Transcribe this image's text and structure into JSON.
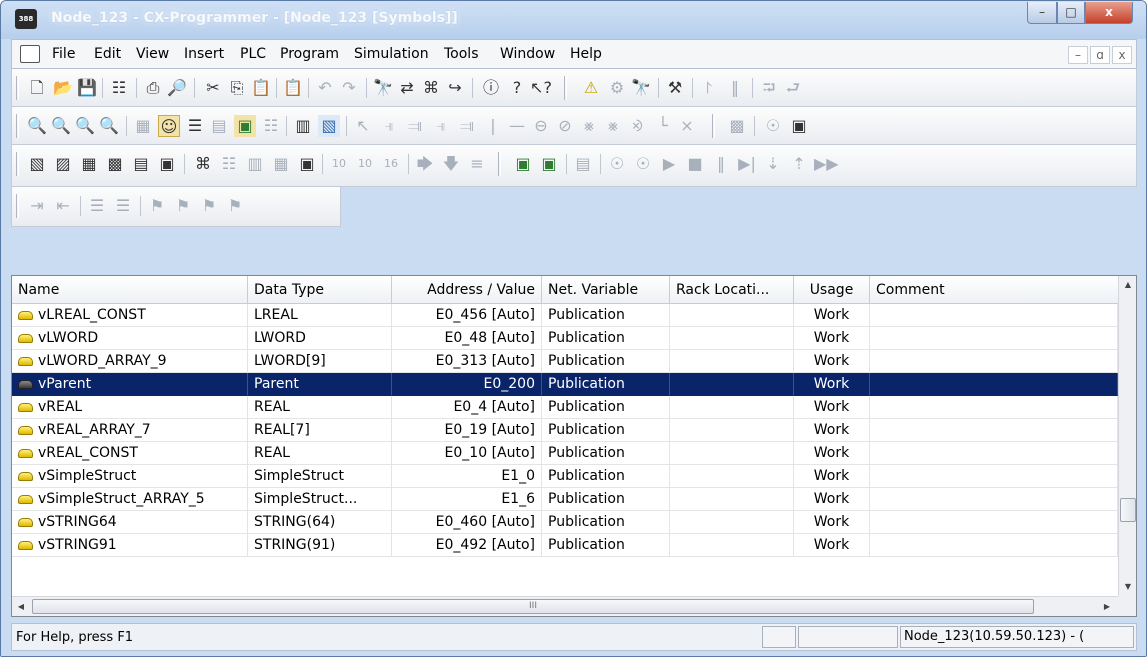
{
  "window": {
    "title": "Node_123 - CX-Programmer - [Node_123 [Symbols]]",
    "app_icon_text": "388",
    "min_label": "–",
    "max_label": "□",
    "close_label": "x"
  },
  "menu": {
    "items": [
      "File",
      "Edit",
      "View",
      "Insert",
      "PLC",
      "Program",
      "Simulation",
      "Tools",
      "Window",
      "Help"
    ],
    "mdi_min": "–",
    "mdi_restore": "ɑ",
    "mdi_close": "x"
  },
  "table": {
    "columns": [
      "Name",
      "Data Type",
      "Address / Value",
      "Net. Variable",
      "Rack Locati...",
      "Usage",
      "Comment"
    ],
    "rows": [
      {
        "name": "vLREAL_CONST",
        "type": "LREAL",
        "address": "E0_456 [Auto]",
        "net": "Publication",
        "rack": "",
        "usage": "Work",
        "comment": ""
      },
      {
        "name": "vLWORD",
        "type": "LWORD",
        "address": "E0_48 [Auto]",
        "net": "Publication",
        "rack": "",
        "usage": "Work",
        "comment": ""
      },
      {
        "name": "vLWORD_ARRAY_9",
        "type": "LWORD[9]",
        "address": "E0_313 [Auto]",
        "net": "Publication",
        "rack": "",
        "usage": "Work",
        "comment": ""
      },
      {
        "name": "vParent",
        "type": "Parent",
        "address": "E0_200",
        "net": "Publication",
        "rack": "",
        "usage": "Work",
        "comment": ""
      },
      {
        "name": "vREAL",
        "type": "REAL",
        "address": "E0_4 [Auto]",
        "net": "Publication",
        "rack": "",
        "usage": "Work",
        "comment": ""
      },
      {
        "name": "vREAL_ARRAY_7",
        "type": "REAL[7]",
        "address": "E0_19 [Auto]",
        "net": "Publication",
        "rack": "",
        "usage": "Work",
        "comment": ""
      },
      {
        "name": "vREAL_CONST",
        "type": "REAL",
        "address": "E0_10 [Auto]",
        "net": "Publication",
        "rack": "",
        "usage": "Work",
        "comment": ""
      },
      {
        "name": "vSimpleStruct",
        "type": "SimpleStruct",
        "address": "E1_0",
        "net": "Publication",
        "rack": "",
        "usage": "Work",
        "comment": ""
      },
      {
        "name": "vSimpleStruct_ARRAY_5",
        "type": "SimpleStruct...",
        "address": "E1_6",
        "net": "Publication",
        "rack": "",
        "usage": "Work",
        "comment": ""
      },
      {
        "name": "vSTRING64",
        "type": "STRING(64)",
        "address": "E0_460 [Auto]",
        "net": "Publication",
        "rack": "",
        "usage": "Work",
        "comment": ""
      },
      {
        "name": "vSTRING91",
        "type": "STRING(91)",
        "address": "E0_492 [Auto]",
        "net": "Publication",
        "rack": "",
        "usage": "Work",
        "comment": ""
      }
    ],
    "selected_row_index": 3
  },
  "scroll": {
    "hscroll_grip": "III"
  },
  "status": {
    "help_text": "For Help, press F1",
    "connection": "Node_123(10.59.50.123) - ("
  },
  "colors": {
    "selection": "#0a246a",
    "title_gradient": "#b7cfec"
  }
}
